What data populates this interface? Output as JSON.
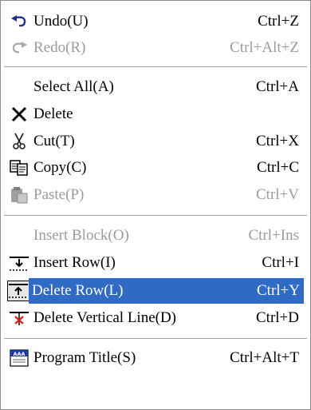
{
  "menu": {
    "items": [
      {
        "label": "Undo(U)",
        "shortcut": "Ctrl+Z",
        "icon": "undo-icon"
      },
      {
        "label": "Redo(R)",
        "shortcut": "Ctrl+Alt+Z",
        "icon": "redo-icon"
      },
      {
        "label": "Select All(A)",
        "shortcut": "Ctrl+A"
      },
      {
        "label": "Delete",
        "shortcut": "",
        "icon": "delete-x-icon"
      },
      {
        "label": "Cut(T)",
        "shortcut": "Ctrl+X",
        "icon": "scissors-icon"
      },
      {
        "label": "Copy(C)",
        "shortcut": "Ctrl+C",
        "icon": "copy-icon"
      },
      {
        "label": "Paste(P)",
        "shortcut": "Ctrl+V",
        "icon": "paste-icon"
      },
      {
        "label": "Insert Block(O)",
        "shortcut": "Ctrl+Ins"
      },
      {
        "label": "Insert Row(I)",
        "shortcut": "Ctrl+I",
        "icon": "insert-row-icon"
      },
      {
        "label": "Delete Row(L)",
        "shortcut": "Ctrl+Y",
        "icon": "delete-row-icon"
      },
      {
        "label": "Delete Vertical Line(D)",
        "shortcut": "Ctrl+D",
        "icon": "delete-vertical-line-icon"
      },
      {
        "label": "Program Title(S)",
        "shortcut": "Ctrl+Alt+T",
        "icon": "program-title-icon",
        "icon_text": "AAA"
      }
    ]
  },
  "colors": {
    "highlight": "#316ac5",
    "disabled": "#9b9b9b"
  }
}
